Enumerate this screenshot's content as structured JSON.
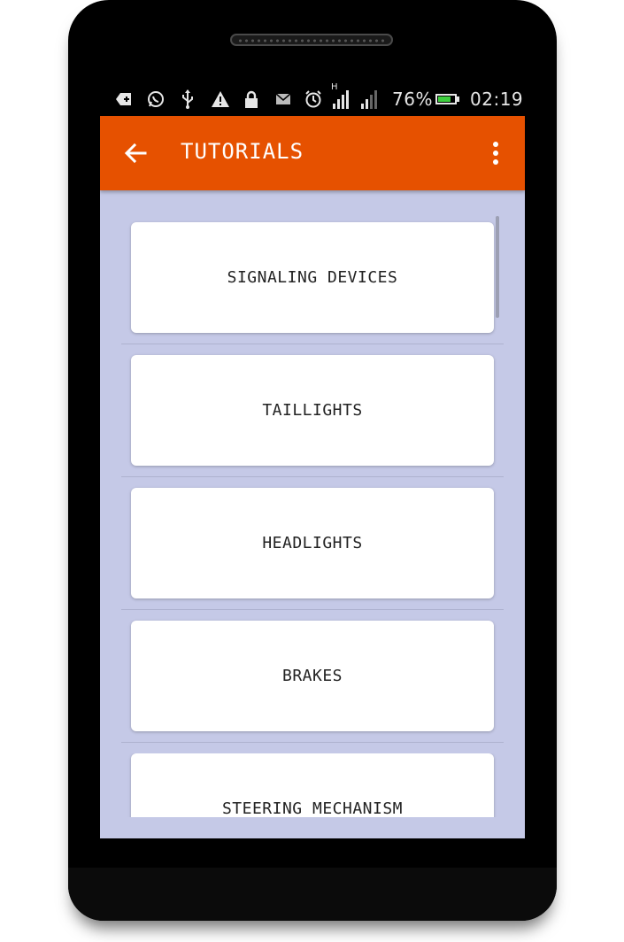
{
  "status_bar": {
    "battery_text": "76%",
    "time": "02:19",
    "network_type": "H",
    "battery_level": 0.76,
    "icons": [
      "add-notification-icon",
      "whatsapp-icon",
      "usb-icon",
      "warning-icon",
      "lock-icon",
      "mail-icon",
      "alarm-icon",
      "signal-icon",
      "signal-icon",
      "battery-icon"
    ]
  },
  "app_bar": {
    "title": "TUTORIALS",
    "back_icon": "arrow-left-icon",
    "menu_icon": "more-vert-icon",
    "color": "#e65100"
  },
  "list": {
    "items": [
      {
        "label": "SIGNALING DEVICES"
      },
      {
        "label": "TAILLIGHTS"
      },
      {
        "label": "HEADLIGHTS"
      },
      {
        "label": "BRAKES"
      },
      {
        "label": "STEERING MECHANISM"
      }
    ],
    "background": "#c5c9e7"
  }
}
